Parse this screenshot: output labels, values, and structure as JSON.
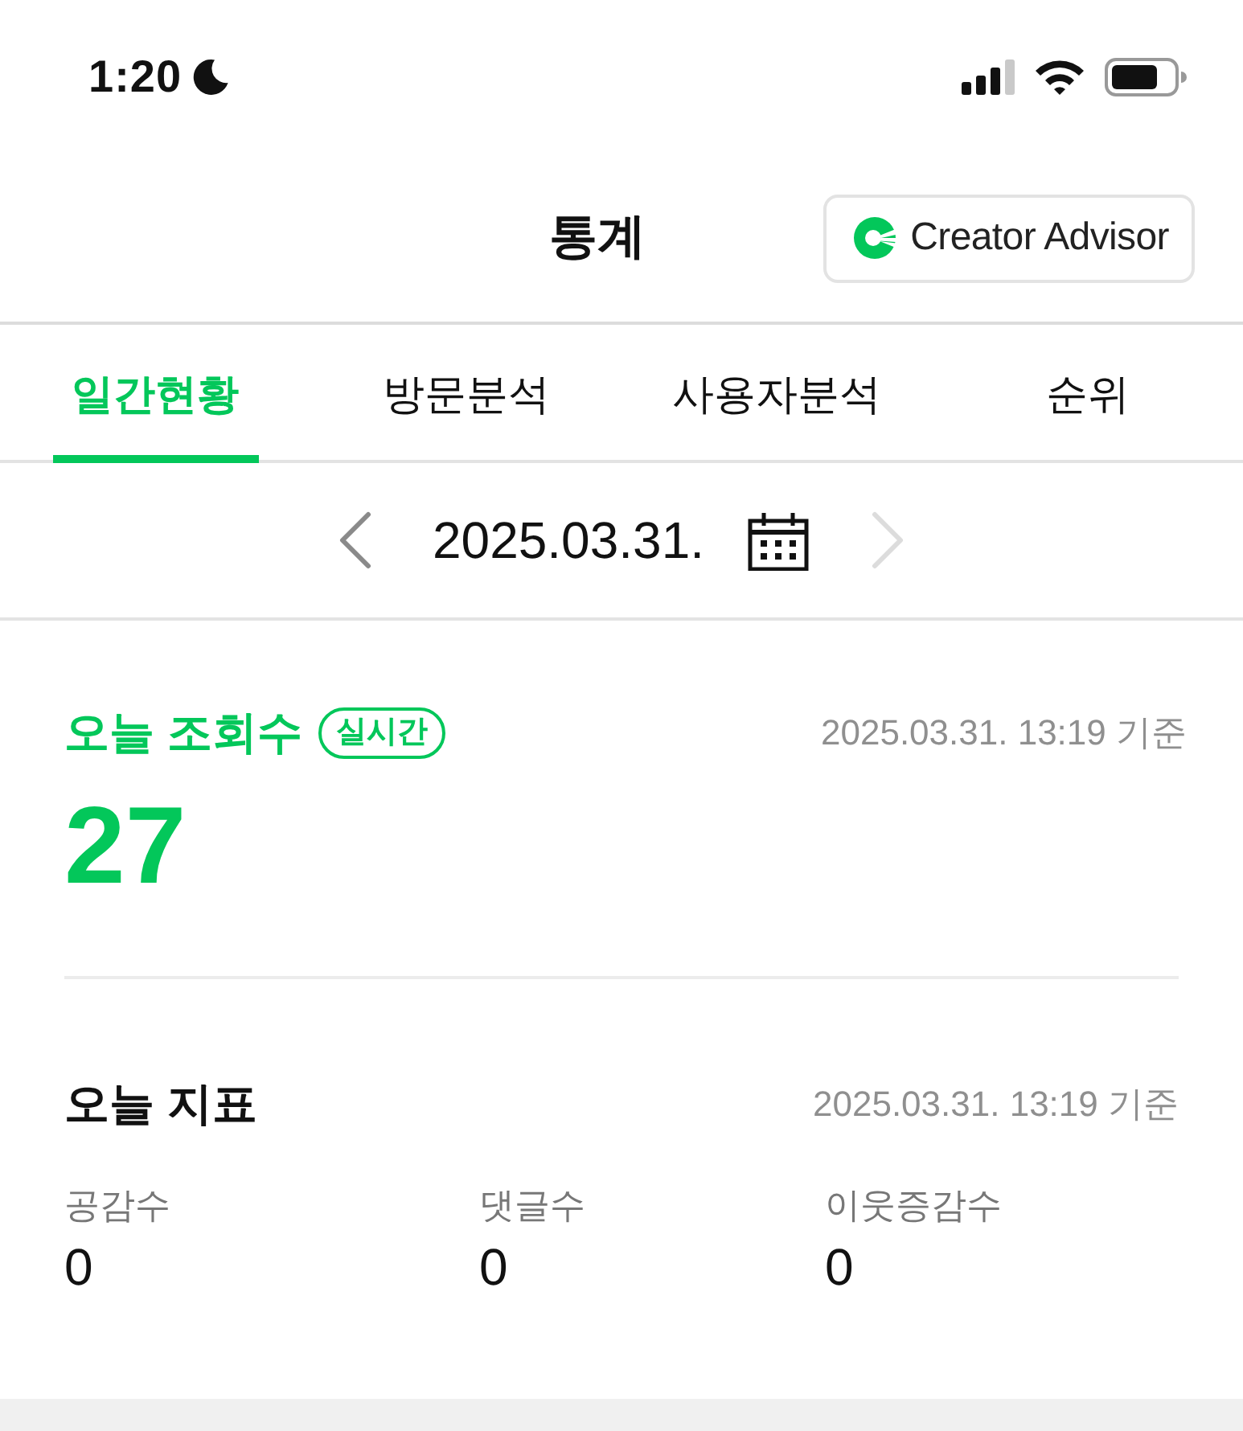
{
  "status_bar": {
    "time": "1:20"
  },
  "header": {
    "title": "통계",
    "button": "Creator Advisor"
  },
  "tabs": [
    {
      "label": "일간현황",
      "selected": true
    },
    {
      "label": "방문분석",
      "selected": false
    },
    {
      "label": "사용자분석",
      "selected": false
    },
    {
      "label": "순위",
      "selected": false
    }
  ],
  "date_nav": {
    "prev": {
      "disabled": false
    },
    "date": "2025.03.31.",
    "next": {
      "disabled": true
    }
  },
  "today_views": {
    "title": "오늘 조회수",
    "badge": "실시간",
    "timestamp": "2025.03.31. 13:19 기준",
    "value": "27"
  },
  "today_metrics": {
    "title": "오늘 지표",
    "timestamp": "2025.03.31. 13:19 기준",
    "metrics": [
      {
        "label": "공감수",
        "value": "0"
      },
      {
        "label": "댓글수",
        "value": "0"
      },
      {
        "label": "이웃증감수",
        "value": "0"
      }
    ]
  }
}
